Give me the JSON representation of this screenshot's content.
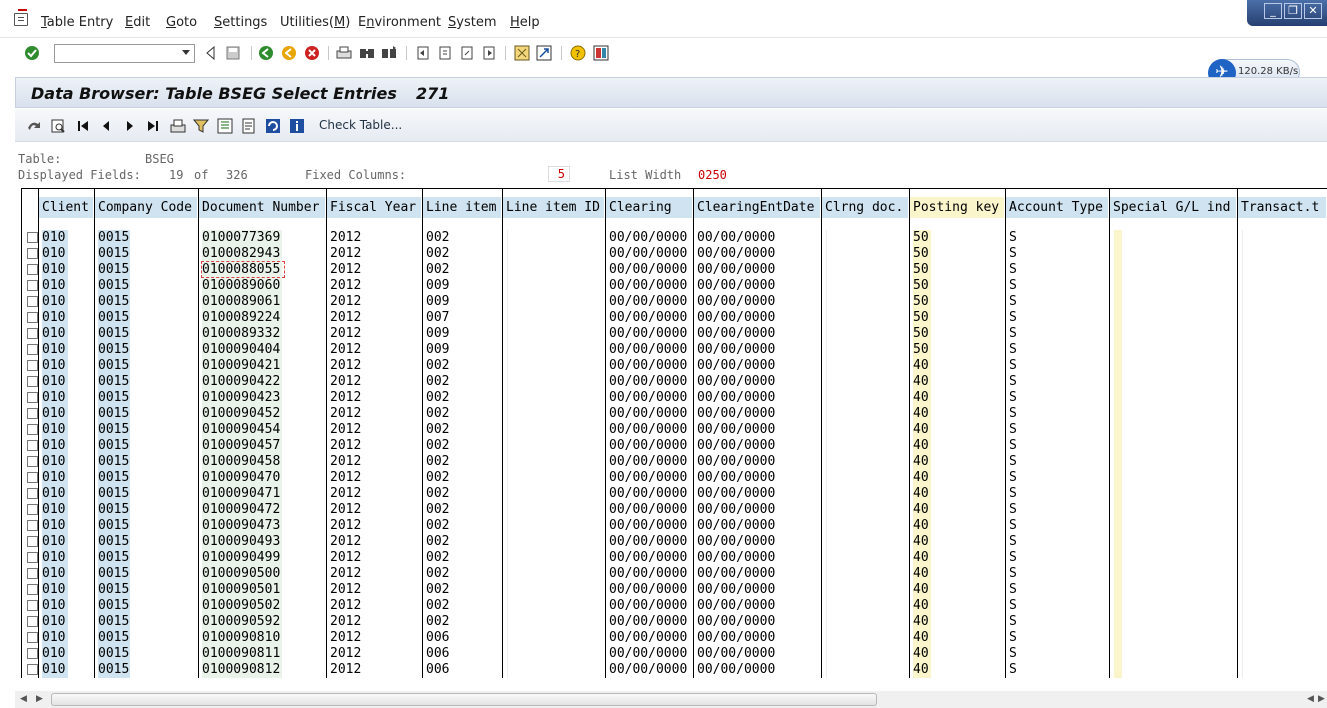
{
  "menu": {
    "items": [
      {
        "label": "Table Entry",
        "ul": "T",
        "rest": "able Entry"
      },
      {
        "label": "Edit",
        "ul": "E",
        "rest": "dit"
      },
      {
        "label": "Goto",
        "ul": "G",
        "rest": "oto"
      },
      {
        "label": "Settings",
        "ul": "S",
        "rest": "ettings"
      },
      {
        "label": "Utilities(M)",
        "pre": "Utilities(",
        "ul": "M",
        "post": ")"
      },
      {
        "label": "Environment",
        "pre": "E",
        "ul": "n",
        "post": "vironment"
      },
      {
        "label": "System",
        "ul": "S",
        "rest": "ystem"
      },
      {
        "label": "Help",
        "ul": "H",
        "rest": "elp"
      }
    ]
  },
  "command_field": {
    "value": ""
  },
  "network": {
    "speed": "120.28 KB/s"
  },
  "screen": {
    "title": "Data Browser: Table BSEG Select Entries",
    "count": "271"
  },
  "app_toolbar": {
    "check_table": "Check Table..."
  },
  "info": {
    "table_label": "Table:",
    "table_value": "BSEG",
    "displayed_label": "Displayed Fields:",
    "displayed_value": "19",
    "of_label": "of",
    "total_fields": "326",
    "fixed_label": "Fixed Columns:",
    "fixed_value": "5",
    "width_label": "List Width",
    "width_value": "0250"
  },
  "table": {
    "headers": [
      "Client",
      "Company Code",
      "Document Number",
      "Fiscal Year",
      "Line item",
      "Line item ID",
      "Clearing",
      "ClearingEntDate",
      "Clrng doc.",
      "Posting key",
      "Account Type",
      "Special G/L ind",
      "Transact.t"
    ],
    "rows": [
      [
        "010",
        "0015",
        "0100077369",
        "2012",
        "002",
        "00/00/0000",
        "00/00/0000",
        "50",
        "S"
      ],
      [
        "010",
        "0015",
        "0100082943",
        "2012",
        "002",
        "00/00/0000",
        "00/00/0000",
        "50",
        "S"
      ],
      [
        "010",
        "0015",
        "0100088055",
        "2012",
        "002",
        "00/00/0000",
        "00/00/0000",
        "50",
        "S"
      ],
      [
        "010",
        "0015",
        "0100089060",
        "2012",
        "009",
        "00/00/0000",
        "00/00/0000",
        "50",
        "S"
      ],
      [
        "010",
        "0015",
        "0100089061",
        "2012",
        "009",
        "00/00/0000",
        "00/00/0000",
        "50",
        "S"
      ],
      [
        "010",
        "0015",
        "0100089224",
        "2012",
        "007",
        "00/00/0000",
        "00/00/0000",
        "50",
        "S"
      ],
      [
        "010",
        "0015",
        "0100089332",
        "2012",
        "009",
        "00/00/0000",
        "00/00/0000",
        "50",
        "S"
      ],
      [
        "010",
        "0015",
        "0100090404",
        "2012",
        "009",
        "00/00/0000",
        "00/00/0000",
        "50",
        "S"
      ],
      [
        "010",
        "0015",
        "0100090421",
        "2012",
        "002",
        "00/00/0000",
        "00/00/0000",
        "40",
        "S"
      ],
      [
        "010",
        "0015",
        "0100090422",
        "2012",
        "002",
        "00/00/0000",
        "00/00/0000",
        "40",
        "S"
      ],
      [
        "010",
        "0015",
        "0100090423",
        "2012",
        "002",
        "00/00/0000",
        "00/00/0000",
        "40",
        "S"
      ],
      [
        "010",
        "0015",
        "0100090452",
        "2012",
        "002",
        "00/00/0000",
        "00/00/0000",
        "40",
        "S"
      ],
      [
        "010",
        "0015",
        "0100090454",
        "2012",
        "002",
        "00/00/0000",
        "00/00/0000",
        "40",
        "S"
      ],
      [
        "010",
        "0015",
        "0100090457",
        "2012",
        "002",
        "00/00/0000",
        "00/00/0000",
        "40",
        "S"
      ],
      [
        "010",
        "0015",
        "0100090458",
        "2012",
        "002",
        "00/00/0000",
        "00/00/0000",
        "40",
        "S"
      ],
      [
        "010",
        "0015",
        "0100090470",
        "2012",
        "002",
        "00/00/0000",
        "00/00/0000",
        "40",
        "S"
      ],
      [
        "010",
        "0015",
        "0100090471",
        "2012",
        "002",
        "00/00/0000",
        "00/00/0000",
        "40",
        "S"
      ],
      [
        "010",
        "0015",
        "0100090472",
        "2012",
        "002",
        "00/00/0000",
        "00/00/0000",
        "40",
        "S"
      ],
      [
        "010",
        "0015",
        "0100090473",
        "2012",
        "002",
        "00/00/0000",
        "00/00/0000",
        "40",
        "S"
      ],
      [
        "010",
        "0015",
        "0100090493",
        "2012",
        "002",
        "00/00/0000",
        "00/00/0000",
        "40",
        "S"
      ],
      [
        "010",
        "0015",
        "0100090499",
        "2012",
        "002",
        "00/00/0000",
        "00/00/0000",
        "40",
        "S"
      ],
      [
        "010",
        "0015",
        "0100090500",
        "2012",
        "002",
        "00/00/0000",
        "00/00/0000",
        "40",
        "S"
      ],
      [
        "010",
        "0015",
        "0100090501",
        "2012",
        "002",
        "00/00/0000",
        "00/00/0000",
        "40",
        "S"
      ],
      [
        "010",
        "0015",
        "0100090502",
        "2012",
        "002",
        "00/00/0000",
        "00/00/0000",
        "40",
        "S"
      ],
      [
        "010",
        "0015",
        "0100090592",
        "2012",
        "002",
        "00/00/0000",
        "00/00/0000",
        "40",
        "S"
      ],
      [
        "010",
        "0015",
        "0100090810",
        "2012",
        "006",
        "00/00/0000",
        "00/00/0000",
        "40",
        "S"
      ],
      [
        "010",
        "0015",
        "0100090811",
        "2012",
        "006",
        "00/00/0000",
        "00/00/0000",
        "40",
        "S"
      ],
      [
        "010",
        "0015",
        "0100090812",
        "2012",
        "006",
        "00/00/0000",
        "00/00/0000",
        "40",
        "S"
      ]
    ]
  },
  "colors": {
    "key_blue": "#cfe3f0",
    "doc_green": "#e9f3ea",
    "posting_yellow": "#fbf5cc",
    "title_grad": "#d8e1ed",
    "fixed_red": "#cc0000"
  },
  "icons": [
    "enter-check-icon",
    "back-icon",
    "save-icon",
    "green-back-icon",
    "exit-icon",
    "cancel-icon",
    "print-icon",
    "find-icon",
    "find-next-icon",
    "first-page-icon",
    "previous-page-icon",
    "next-page-icon",
    "last-page-icon",
    "create-session-icon",
    "shortcut-icon",
    "help-icon",
    "layout-icon",
    "details-icon",
    "print-preview-icon",
    "first-icon",
    "previous-icon",
    "next-icon",
    "last-icon",
    "print-list-icon",
    "filter-icon",
    "sum-icon",
    "export-icon",
    "refresh-icon",
    "info-icon"
  ]
}
